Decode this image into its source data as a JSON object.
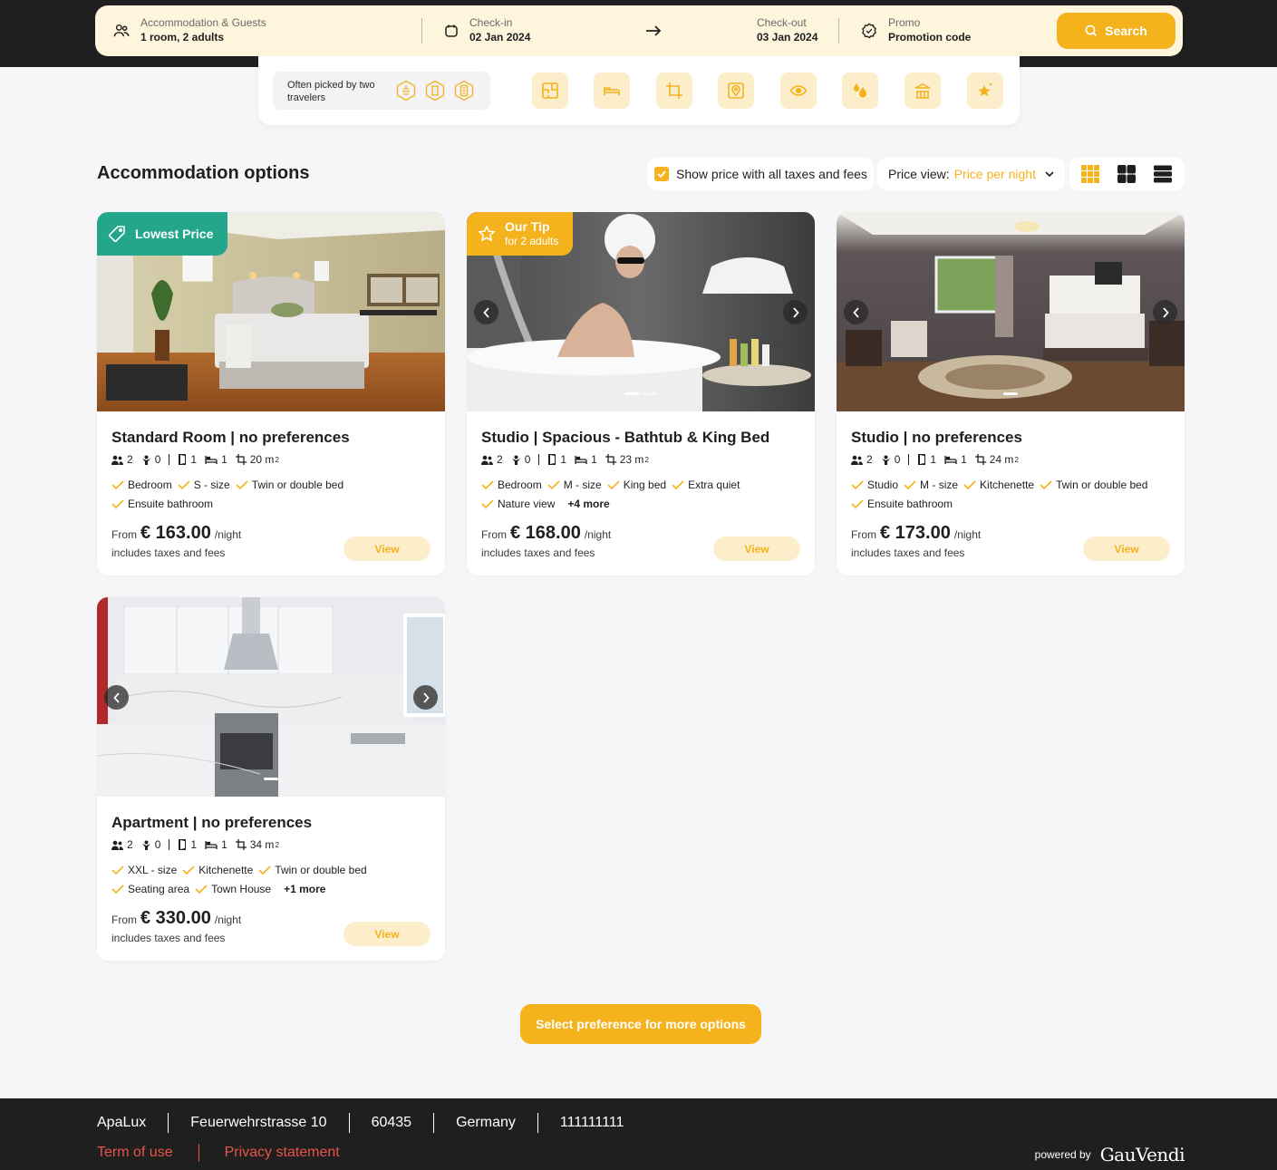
{
  "search": {
    "guests_label": "Accommodation & Guests",
    "guests_value": "1 room, 2 adults",
    "checkin_label": "Check-in",
    "checkin_value": "02 Jan 2024",
    "checkout_label": "Check-out",
    "checkout_value": "03 Jan 2024",
    "promo_label": "Promo",
    "promo_value": "Promotion code",
    "search_label": "Search"
  },
  "preferences": {
    "often_picked": "Often picked by two travelers",
    "icons": [
      "floorplan-icon",
      "bed-icon",
      "area-icon",
      "location-icon",
      "view-icon",
      "bath-icon",
      "balcony-icon",
      "star-sparkle-icon"
    ]
  },
  "options": {
    "title": "Accommodation options",
    "tax_toggle": "Show price with all taxes and fees",
    "price_view_label": "Price view:",
    "price_view_value": "Price per night"
  },
  "rooms": [
    {
      "badge_title": "Lowest Price",
      "title": "Standard Room | no preferences",
      "adults": "2",
      "children": "0",
      "rooms": "1",
      "beds": "1",
      "area": "20 m",
      "features_row1": [
        "Bedroom",
        "S - size",
        "Twin or double bed"
      ],
      "features_row2": [
        "Ensuite bathroom"
      ],
      "more": "",
      "from": "From",
      "price": "€ 163.00",
      "per": "/night",
      "includes": "includes taxes and fees",
      "view": "View"
    },
    {
      "badge_title": "Our Tip",
      "badge_sub": "for 2 adults",
      "title": "Studio | Spacious - Bathtub & King Bed",
      "adults": "2",
      "children": "0",
      "rooms": "1",
      "beds": "1",
      "area": "23 m",
      "features_row1": [
        "Bedroom",
        "M - size",
        "King bed",
        "Extra quiet"
      ],
      "features_row2": [
        "Nature view"
      ],
      "more": "+4 more",
      "from": "From",
      "price": "€ 168.00",
      "per": "/night",
      "includes": "includes taxes and fees",
      "view": "View"
    },
    {
      "title": "Studio | no preferences",
      "adults": "2",
      "children": "0",
      "rooms": "1",
      "beds": "1",
      "area": "24 m",
      "features_row1": [
        "Studio",
        "M - size",
        "Kitchenette",
        "Twin or double bed"
      ],
      "features_row2": [
        "Ensuite bathroom"
      ],
      "more": "",
      "from": "From",
      "price": "€ 173.00",
      "per": "/night",
      "includes": "includes taxes and fees",
      "view": "View"
    },
    {
      "title": "Apartment | no preferences",
      "adults": "2",
      "children": "0",
      "rooms": "1",
      "beds": "1",
      "area": "34 m",
      "features_row1": [
        "XXL - size",
        "Kitchenette",
        "Twin or double bed"
      ],
      "features_row2": [
        "Seating area",
        "Town House"
      ],
      "more": "+1 more",
      "from": "From",
      "price": "€ 330.00",
      "per": "/night",
      "includes": "includes taxes and fees",
      "view": "View"
    }
  ],
  "more_options_label": "Select preference for more options",
  "footer": {
    "name": "ApaLux",
    "street": "Feuerwehrstrasse 10",
    "zip": "60435",
    "country": "Germany",
    "phone": "111111111",
    "terms": "Term of use",
    "privacy": "Privacy statement",
    "powered_by": "powered by",
    "brand": "GauVendi"
  },
  "colors": {
    "accent": "#f4b21c",
    "accent_soft": "#fdeecb",
    "green_badge": "#23a68b",
    "dark": "#1f1f1f",
    "footer_link": "#e8534a"
  }
}
